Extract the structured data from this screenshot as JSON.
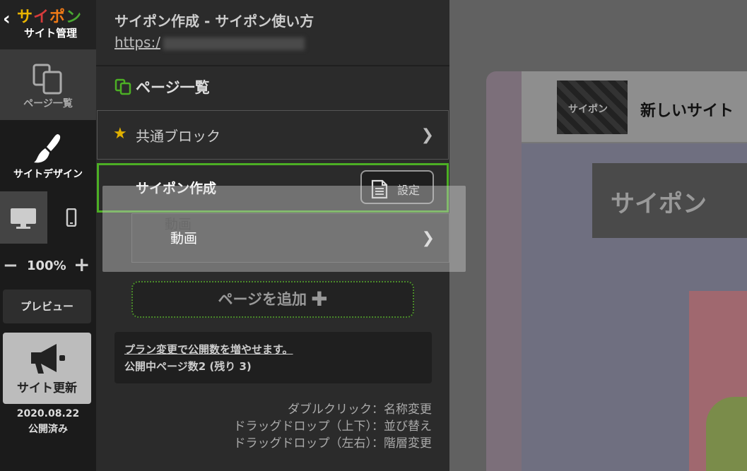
{
  "rail": {
    "back_glyph": "‹",
    "brand": [
      "サ",
      "イ",
      "ポ",
      "ン"
    ],
    "brand_sub": "サイト管理",
    "pages_label": "ページ一覧",
    "design_label": "サイトデザイン",
    "zoom_value": "100%",
    "zoom_minus": "−",
    "zoom_plus": "+",
    "preview_label": "プレビュー",
    "update_label": "サイト更新",
    "published_date": "2020.08.22",
    "published_status": "公開済み"
  },
  "panel": {
    "site_title": "サイポン作成 - サイポン使い方",
    "site_url_prefix": "https:/",
    "heading": "ページ一覧",
    "rows": [
      {
        "label": "共通ブロック"
      },
      {
        "label": "サイポン作成",
        "settings_label": "設定"
      },
      {
        "label": "動画"
      }
    ],
    "drag_ghost_label": "動画",
    "add_page_label": "ページを追加",
    "plan_link": "プラン変更で公開数を増やせます。",
    "public_count": "公開中ページ数2 (残り 3)",
    "hints": [
      "ダブルクリック：名称変更",
      "ドラッグドロップ（上下）：並び替え",
      "ドラッグドロップ（左右）：階層変更"
    ]
  },
  "preview": {
    "logo_text": "サイポン",
    "site_name": "新しいサイト",
    "hero_text": "サイポン"
  },
  "colors": {
    "accent_green": "#4caf24",
    "star": "#e0b000",
    "brand_1": "#e8b400",
    "brand_2": "#d63b3b",
    "brand_3": "#f07a16",
    "brand_4": "#4aa832"
  }
}
